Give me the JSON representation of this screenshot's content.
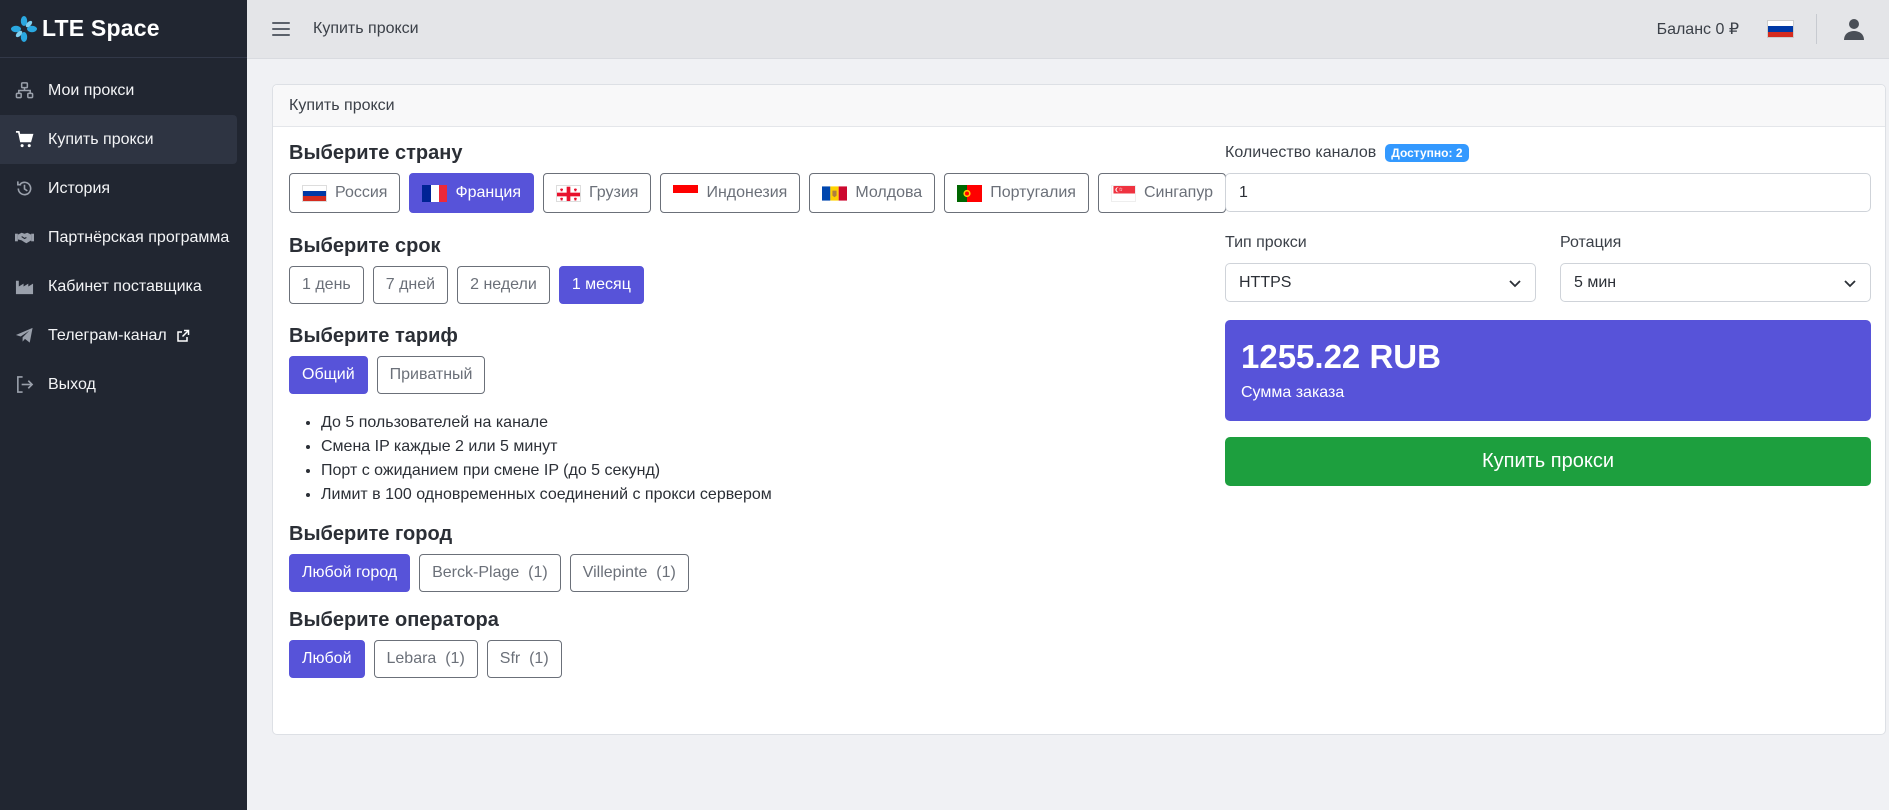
{
  "brand": {
    "name": "LTE Space",
    "icon": "snowflake-logo"
  },
  "sidebar": {
    "items": [
      {
        "label": "Мои прокси",
        "icon": "network-icon",
        "active": false
      },
      {
        "label": "Купить прокси",
        "icon": "cart-icon",
        "active": true
      },
      {
        "label": "История",
        "icon": "history-icon",
        "active": false
      },
      {
        "label": "Партнёрская программа",
        "icon": "handshake-icon",
        "active": false
      },
      {
        "label": "Кабинет поставщика",
        "icon": "factory-icon",
        "active": false
      },
      {
        "label": "Телеграм-канал",
        "icon": "telegram-icon",
        "active": false,
        "external": true
      },
      {
        "label": "Выход",
        "icon": "logout-icon",
        "active": false
      }
    ]
  },
  "header": {
    "title": "Купить прокси",
    "balance": "Баланс 0 ₽"
  },
  "card": {
    "title": "Купить прокси",
    "country": {
      "title": "Выберите страну",
      "options": [
        {
          "label": "Россия",
          "flag": "ru",
          "active": false
        },
        {
          "label": "Франция",
          "flag": "fr",
          "active": true
        },
        {
          "label": "Грузия",
          "flag": "ge",
          "active": false
        },
        {
          "label": "Индонезия",
          "flag": "id",
          "active": false
        },
        {
          "label": "Молдова",
          "flag": "md",
          "active": false
        },
        {
          "label": "Португалия",
          "flag": "pt",
          "active": false
        },
        {
          "label": "Сингапур",
          "flag": "sg",
          "active": false
        }
      ]
    },
    "term": {
      "title": "Выберите срок",
      "options": [
        {
          "label": "1 день",
          "active": false
        },
        {
          "label": "7 дней",
          "active": false
        },
        {
          "label": "2 недели",
          "active": false
        },
        {
          "label": "1 месяц",
          "active": true
        }
      ]
    },
    "tariff": {
      "title": "Выберите тариф",
      "options": [
        {
          "label": "Общий",
          "active": true
        },
        {
          "label": "Приватный",
          "active": false
        }
      ],
      "features": [
        "До 5 пользователей на канале",
        "Смена IP каждые 2 или 5 минут",
        "Порт с ожиданием при смене IP (до 5 секунд)",
        "Лимит в 100 одновременных соединений с прокси сервером"
      ]
    },
    "city": {
      "title": "Выберите город",
      "options": [
        {
          "label": "Любой город",
          "active": true
        },
        {
          "label": "Berck-Plage  (1)",
          "active": false
        },
        {
          "label": "Villepinte  (1)",
          "active": false
        }
      ]
    },
    "operator": {
      "title": "Выберите оператора",
      "options": [
        {
          "label": "Любой",
          "active": true
        },
        {
          "label": "Lebara  (1)",
          "active": false
        },
        {
          "label": "Sfr  (1)",
          "active": false
        }
      ]
    }
  },
  "order": {
    "channels_label": "Количество каналов",
    "available_badge": "Доступно: 2",
    "channels_value": "1",
    "proxy_type_label": "Тип прокси",
    "proxy_type_value": "HTTPS",
    "rotation_label": "Ротация",
    "rotation_value": "5 мин",
    "total_amount": "1255.22 RUB",
    "total_label": "Сумма заказа",
    "buy_button": "Купить прокси"
  },
  "colors": {
    "primary": "#5753d9",
    "success": "#1d9f3e",
    "sidebar_bg": "#212631",
    "badge": "#3399ff"
  }
}
